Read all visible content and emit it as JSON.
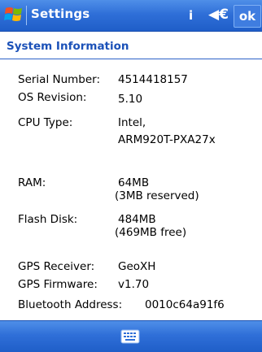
{
  "titlebar": {
    "title": "Settings",
    "ok_label": "ok",
    "info_glyph": "i",
    "volume_glyph": "◀€"
  },
  "section": {
    "title": "System Information"
  },
  "info": {
    "serial_label": "Serial Number:",
    "serial_value": "4514418157",
    "os_label": "OS Revision:",
    "os_value": "5.10",
    "cpu_label": "CPU Type:",
    "cpu_value_line1": "Intel,",
    "cpu_value_line2": "ARM920T-PXA27x",
    "ram_label": "RAM:",
    "ram_value_line1": "64MB",
    "ram_value_line2": "(3MB reserved)",
    "flash_label": "Flash Disk:",
    "flash_value_line1": "484MB",
    "flash_value_line2": "(469MB free)",
    "gps_receiver_label": "GPS Receiver:",
    "gps_receiver_value": "GeoXH",
    "gps_firmware_label": "GPS Firmware:",
    "gps_firmware_value": "v1.70",
    "bluetooth_label": "Bluetooth Address:",
    "bluetooth_value": "0010c64a91f6"
  },
  "icons": {
    "start": "windows-flag-icon",
    "info": "info-icon",
    "volume": "speaker-icon",
    "keyboard": "keyboard-icon"
  },
  "colors": {
    "bar": "#2f6fd8",
    "section_title": "#1b51b8"
  }
}
